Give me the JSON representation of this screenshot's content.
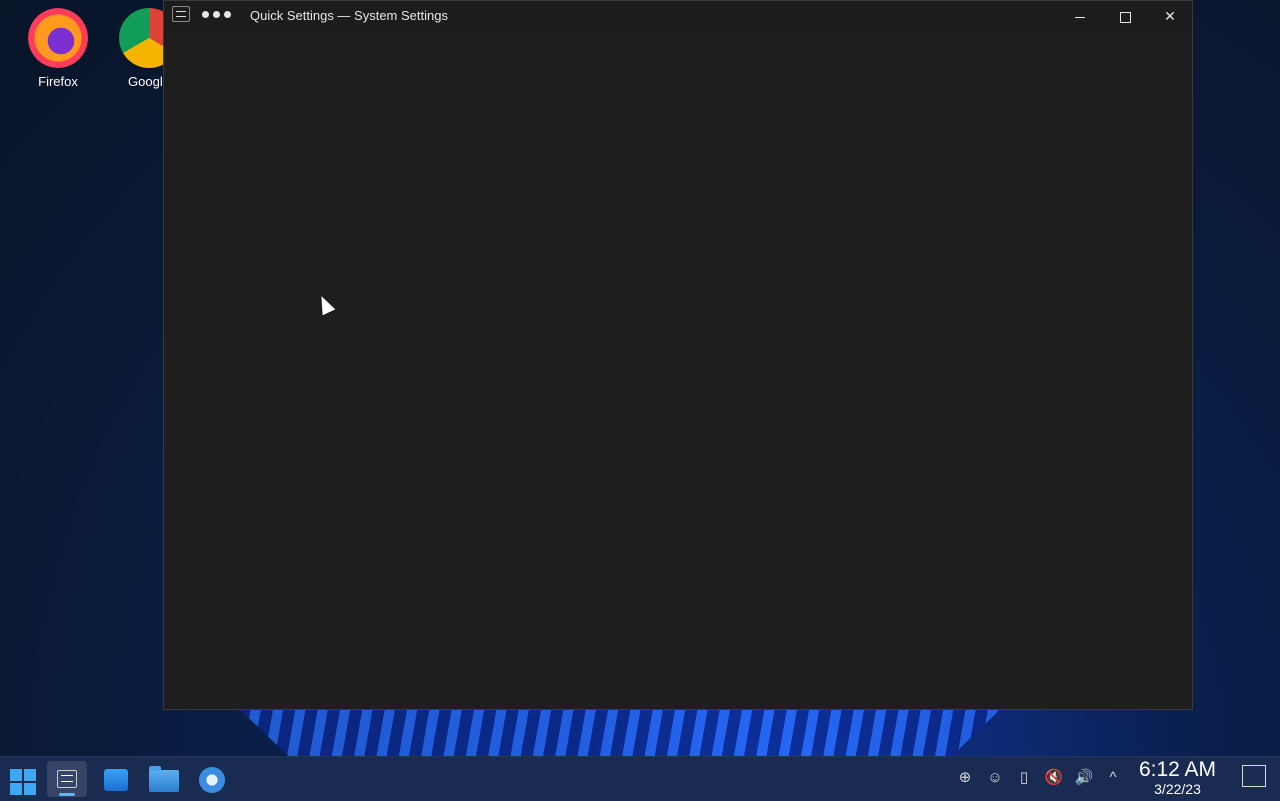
{
  "desktop": {
    "icons": [
      {
        "label": "Firefox",
        "icon": "firefox-icon"
      },
      {
        "label": "Google",
        "icon": "chrome-icon"
      }
    ]
  },
  "window": {
    "title": "Quick Settings — System Settings",
    "controls": {
      "minimize": "minimize-icon",
      "maximize": "maximize-icon",
      "close": "✕"
    }
  },
  "taskbar": {
    "apps": [
      "start-icon",
      "system-settings-icon",
      "store-icon",
      "file-manager-icon",
      "discover-icon"
    ],
    "tray": {
      "icons": [
        "update-icon",
        "account-icon",
        "clipboard-icon",
        "mic-muted-icon",
        "volume-icon",
        "chevron-up-icon"
      ],
      "glyphs": {
        "update": "⊕",
        "account": "☺",
        "clipboard": "▯",
        "mic": "🔇",
        "volume": "🔊",
        "chevron": "^"
      }
    },
    "clock": {
      "time": "6:12 AM",
      "date": "3/22/23"
    }
  },
  "colors": {
    "accent": "#3fa8f5",
    "window_bg": "#1e1e1e",
    "taskbar_bg": "#1a2b52"
  }
}
